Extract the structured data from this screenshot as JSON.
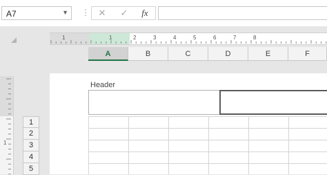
{
  "formula_bar": {
    "name_box": "A7",
    "cancel_icon": "cancel-icon",
    "enter_icon": "check-icon",
    "function_label": "fx",
    "formula_value": ""
  },
  "ruler": {
    "horizontal_numbers": [
      "1",
      "1",
      "2",
      "3",
      "4",
      "5",
      "6",
      "7",
      "8"
    ],
    "vertical_numbers": [
      "1"
    ]
  },
  "columns": [
    "A",
    "B",
    "C",
    "D",
    "E",
    "F"
  ],
  "selected_column": "A",
  "page": {
    "header_label": "Header"
  },
  "rows": [
    "1",
    "2",
    "3",
    "4",
    "5"
  ],
  "colors": {
    "accent": "#217346",
    "ruler_highlight": "#cde8d7"
  }
}
